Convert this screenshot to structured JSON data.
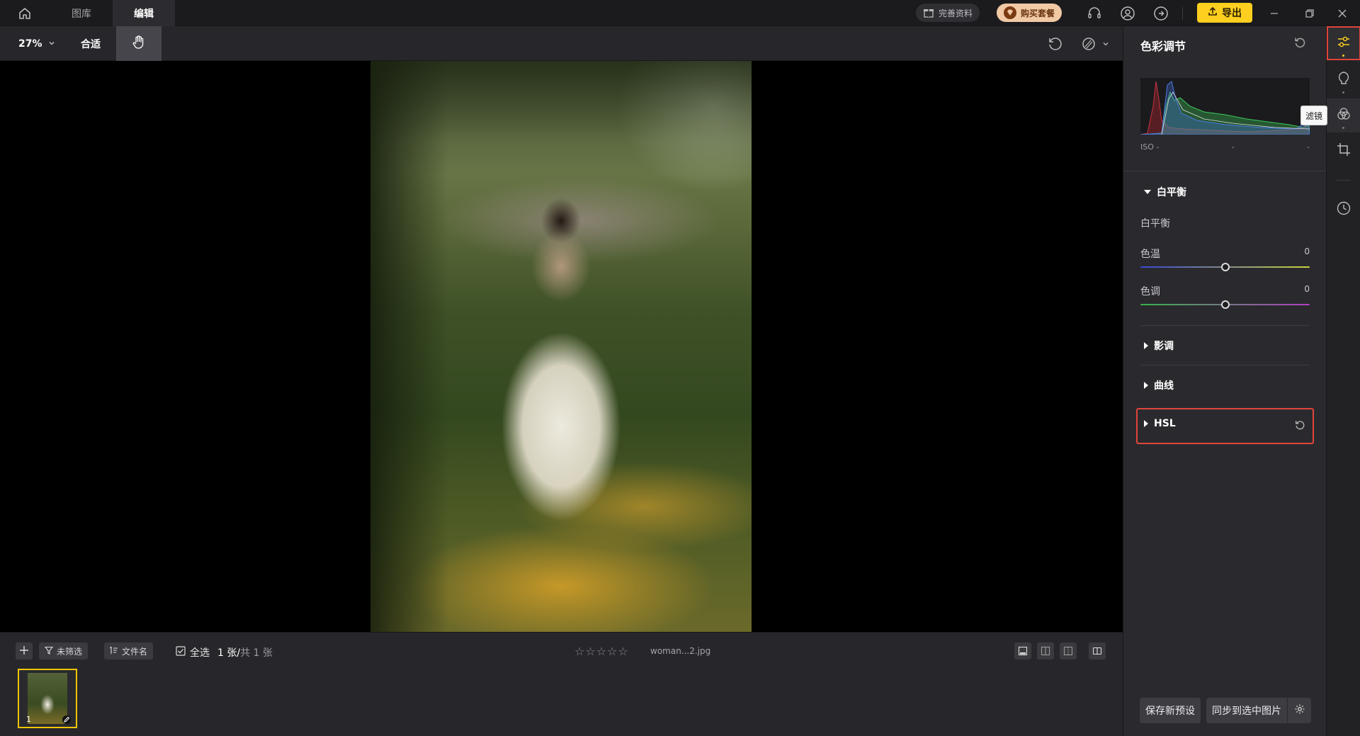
{
  "titlebar": {
    "tabs": [
      {
        "label": "图库"
      },
      {
        "label": "编辑"
      }
    ],
    "profile_label": "完善资料",
    "buy_label": "购买套餐",
    "export_label": "导出"
  },
  "toolbar": {
    "zoom": "27%",
    "fit_label": "合适"
  },
  "bottombar": {
    "filter_label": "未筛选",
    "sort_label": "文件名",
    "select_all_label": "全选",
    "count_current": "1 张/",
    "count_total": "共 1 张",
    "rating_stars": "☆☆☆☆☆",
    "filename": "woman...2.jpg",
    "thumb_number": "1"
  },
  "panel": {
    "title": "色彩调节",
    "iso_label": "ISO -",
    "iso_mid": "-",
    "iso_right": "-",
    "wb_section": "白平衡",
    "wb_sub": "白平衡",
    "temp_label": "色温",
    "temp_value": "0",
    "tint_label": "色调",
    "tint_value": "0",
    "tone_section": "影调",
    "curve_section": "曲线",
    "hsl_section": "HSL",
    "save_preset_label": "保存新预设",
    "sync_label": "同步到选中图片"
  },
  "rail": {
    "tooltip": "滤镜"
  },
  "sliders": {
    "temp_fraction": 0.5,
    "tint_fraction": 0.5
  },
  "colors": {
    "accent": "#ffcf1f",
    "highlight": "#e0443b",
    "buy": "#f1c9a4"
  }
}
